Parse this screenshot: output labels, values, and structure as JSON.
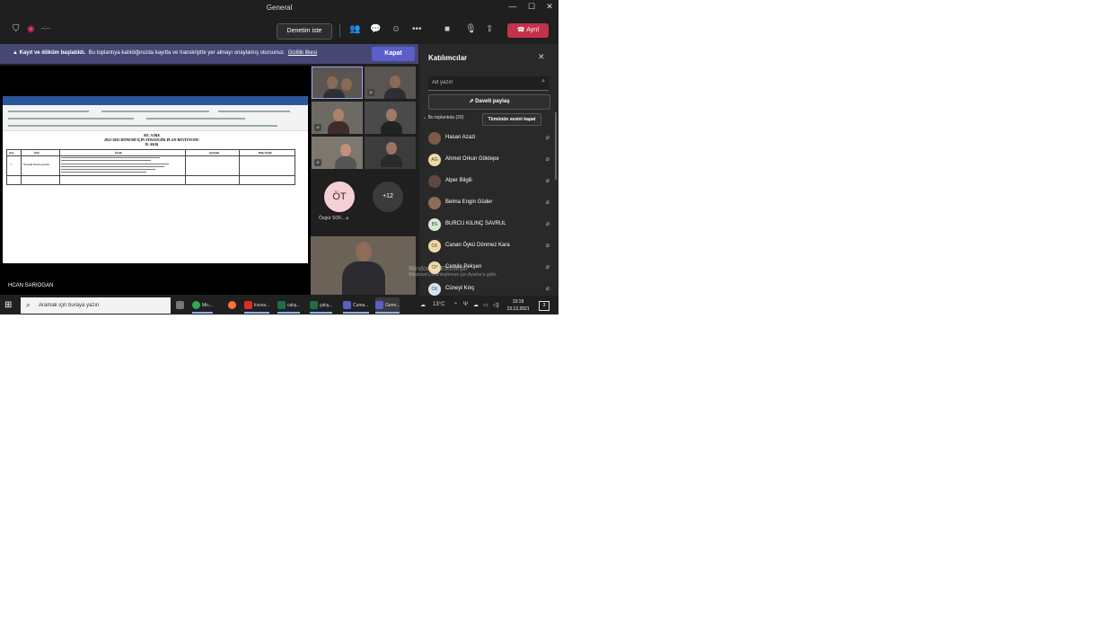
{
  "window": {
    "title": "General"
  },
  "toolbar": {
    "meeting_time": "--:--",
    "request_control_label": "Denetim iste",
    "leave_label": "Ayrıl"
  },
  "banner": {
    "bold_text": "Kayıt ve döküm başlatıldı.",
    "text": "Bu toplantıya katıldığınızda kayıtta ve transkriptte yer almayı onaylamış olursunuz.",
    "link": "Gizlilik ilkesi",
    "close_label": "Kapat"
  },
  "stage": {
    "presenter_name": "HCAN SARIOGAN",
    "doc_heading1": "SİC A İRE",
    "doc_heading2": "2021-2025 DÖNEMİ İÇİN STRATEJİK PLAN REVİZYONU",
    "doc_heading3": "İL AKIŞ",
    "doc_cols": [
      "Sıra",
      "İçler",
      "İçerik",
      "Sorumlu",
      "Bitiş Tarihi"
    ],
    "doc_row_num": "1",
    "doc_row_label": "Stratejik Durum Analizi"
  },
  "gallery": {
    "avatar_initials": "ÖT",
    "avatar_name": "Özgür SOF...",
    "more_count": "+12"
  },
  "participants": {
    "title": "Katılımcılar",
    "search_placeholder": "Ad yazın",
    "share_label": "Daveti paylaş",
    "section_label": "Bu toplantıda (20)",
    "mute_all_label": "Tümünün sesini kapat",
    "people": [
      {
        "name": "Hasan Azazi",
        "initials": ""
      },
      {
        "name": "Ahmet Orkun Göktepe",
        "initials": "AG"
      },
      {
        "name": "Alper Bilgili",
        "initials": ""
      },
      {
        "name": "Belma Engin Güder",
        "initials": ""
      },
      {
        "name": "BURCU KILINÇ SAVRUL",
        "initials": "BS"
      },
      {
        "name": "Canan Öykü Dönmez Kara",
        "initials": "CK"
      },
      {
        "name": "Cemile Pekşen",
        "initials": "CP"
      },
      {
        "name": "Cüneyt Kılıç",
        "initials": "CK"
      }
    ]
  },
  "watermark": {
    "line1": "Windows'u Etkinleştir",
    "line2": "Windows'u etkinleştirmek için Ayarlar'a gidin."
  },
  "taskbar": {
    "search_placeholder": "Aramak için buraya yazın",
    "apps": [
      "Mic...",
      "",
      "kısıva...",
      "calış...",
      "çalış...",
      "Cuma...",
      "Gene..."
    ],
    "temperature": "13°C",
    "time": "13:19",
    "date": "13.12.2021",
    "notif_count": "3"
  },
  "colors": {
    "accent": "#5b5fc7",
    "banner": "#464775",
    "leave": "#c4314b"
  }
}
